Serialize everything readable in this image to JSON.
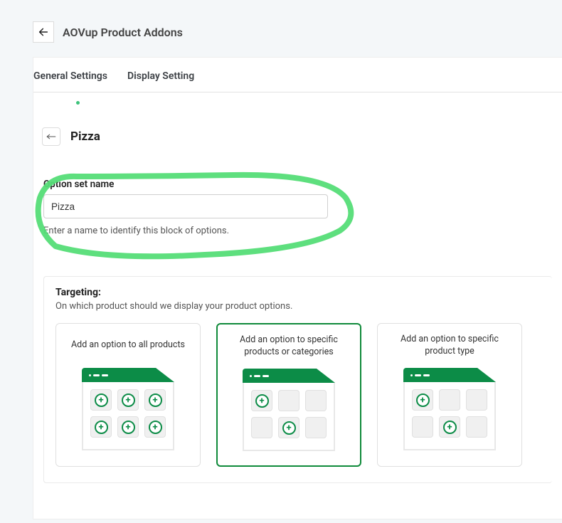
{
  "header": {
    "title": "AOVup Product Addons"
  },
  "tabs": {
    "general": "General Settings",
    "display": "Display Setting"
  },
  "sub": {
    "title": "Pizza"
  },
  "option_set": {
    "label": "Option set name",
    "value": "Pizza",
    "helper": "Enter a name to identify this block of options."
  },
  "targeting": {
    "title": "Targeting:",
    "sub": "On which product should we display your product options.",
    "cards": [
      {
        "label": "Add an option to all products"
      },
      {
        "label": "Add an option to specific products or categories"
      },
      {
        "label": "Add an option to specific product type"
      }
    ],
    "selected_index": 1
  }
}
